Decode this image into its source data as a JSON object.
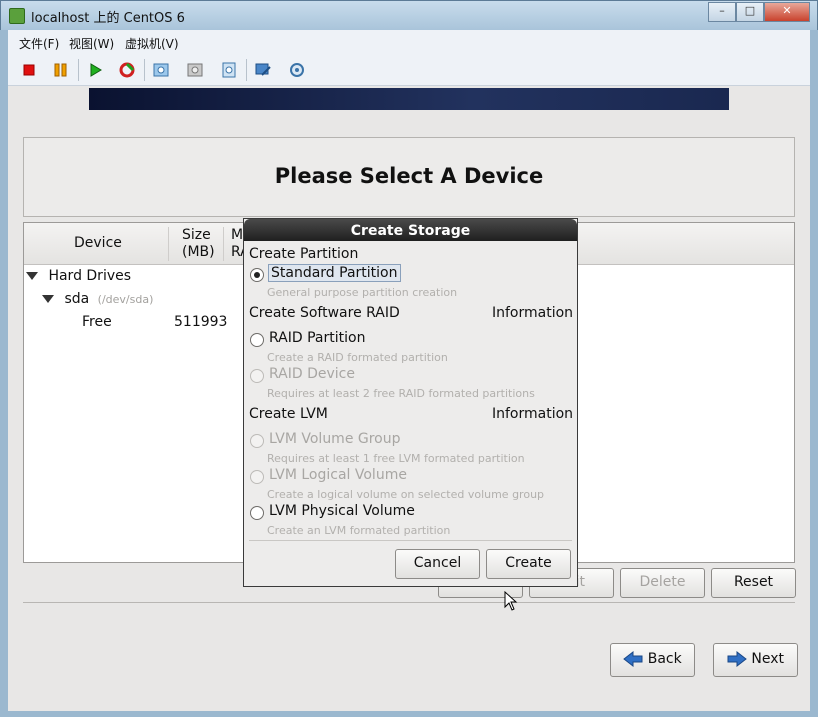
{
  "window": {
    "title": "localhost 上的 CentOS 6",
    "min": "–",
    "max": "□",
    "close": "✕"
  },
  "menubar": [
    {
      "label": "文件(F)"
    },
    {
      "label": "视图(W)"
    },
    {
      "label": "虚拟机(V)"
    }
  ],
  "toolbar": {
    "icons": [
      "stop-icon",
      "pause-icon",
      "play-icon",
      "refresh-icon",
      "snapshot-icon",
      "snapshot-restore-icon",
      "snapshot-manage-icon",
      "console-icon",
      "settings-icon"
    ],
    "colors": {
      "stop": "#e01010",
      "pause": "#f0a000",
      "play": "#20b020"
    }
  },
  "installer": {
    "heading": "Please Select A Device",
    "columns": {
      "device": "Device",
      "size": "Size\n(MB)",
      "mount": "M\nRA"
    },
    "tree": {
      "hard_drives": "Hard Drives",
      "sda": "sda",
      "sda_path": "(/dev/sda)",
      "free_label": "Free",
      "free_size": "511993"
    },
    "buttons": {
      "create": "Create",
      "edit": "Edit",
      "delete": "Delete",
      "reset": "Reset",
      "back": "Back",
      "next": "Next"
    }
  },
  "dialog": {
    "title": "Create Storage",
    "partition_header": "Create Partition",
    "standard_partition": "Standard Partition",
    "standard_partition_desc": "General purpose partition creation",
    "raid_header": "Create Software RAID",
    "raid_info": "Information",
    "raid_partition": "RAID Partition",
    "raid_partition_desc": "Create a RAID formated partition",
    "raid_device": "RAID Device",
    "raid_device_desc": "Requires at least 2 free RAID formated partitions",
    "lvm_header": "Create LVM",
    "lvm_info": "Information",
    "lvm_vg": "LVM Volume Group",
    "lvm_vg_desc": "Requires at least 1 free LVM formated partition",
    "lvm_lv": "LVM Logical Volume",
    "lvm_lv_desc": "Create a logical volume on selected volume group",
    "lvm_pv": "LVM Physical Volume",
    "lvm_pv_desc": "Create an LVM formated partition",
    "cancel": "Cancel",
    "create": "Create"
  }
}
